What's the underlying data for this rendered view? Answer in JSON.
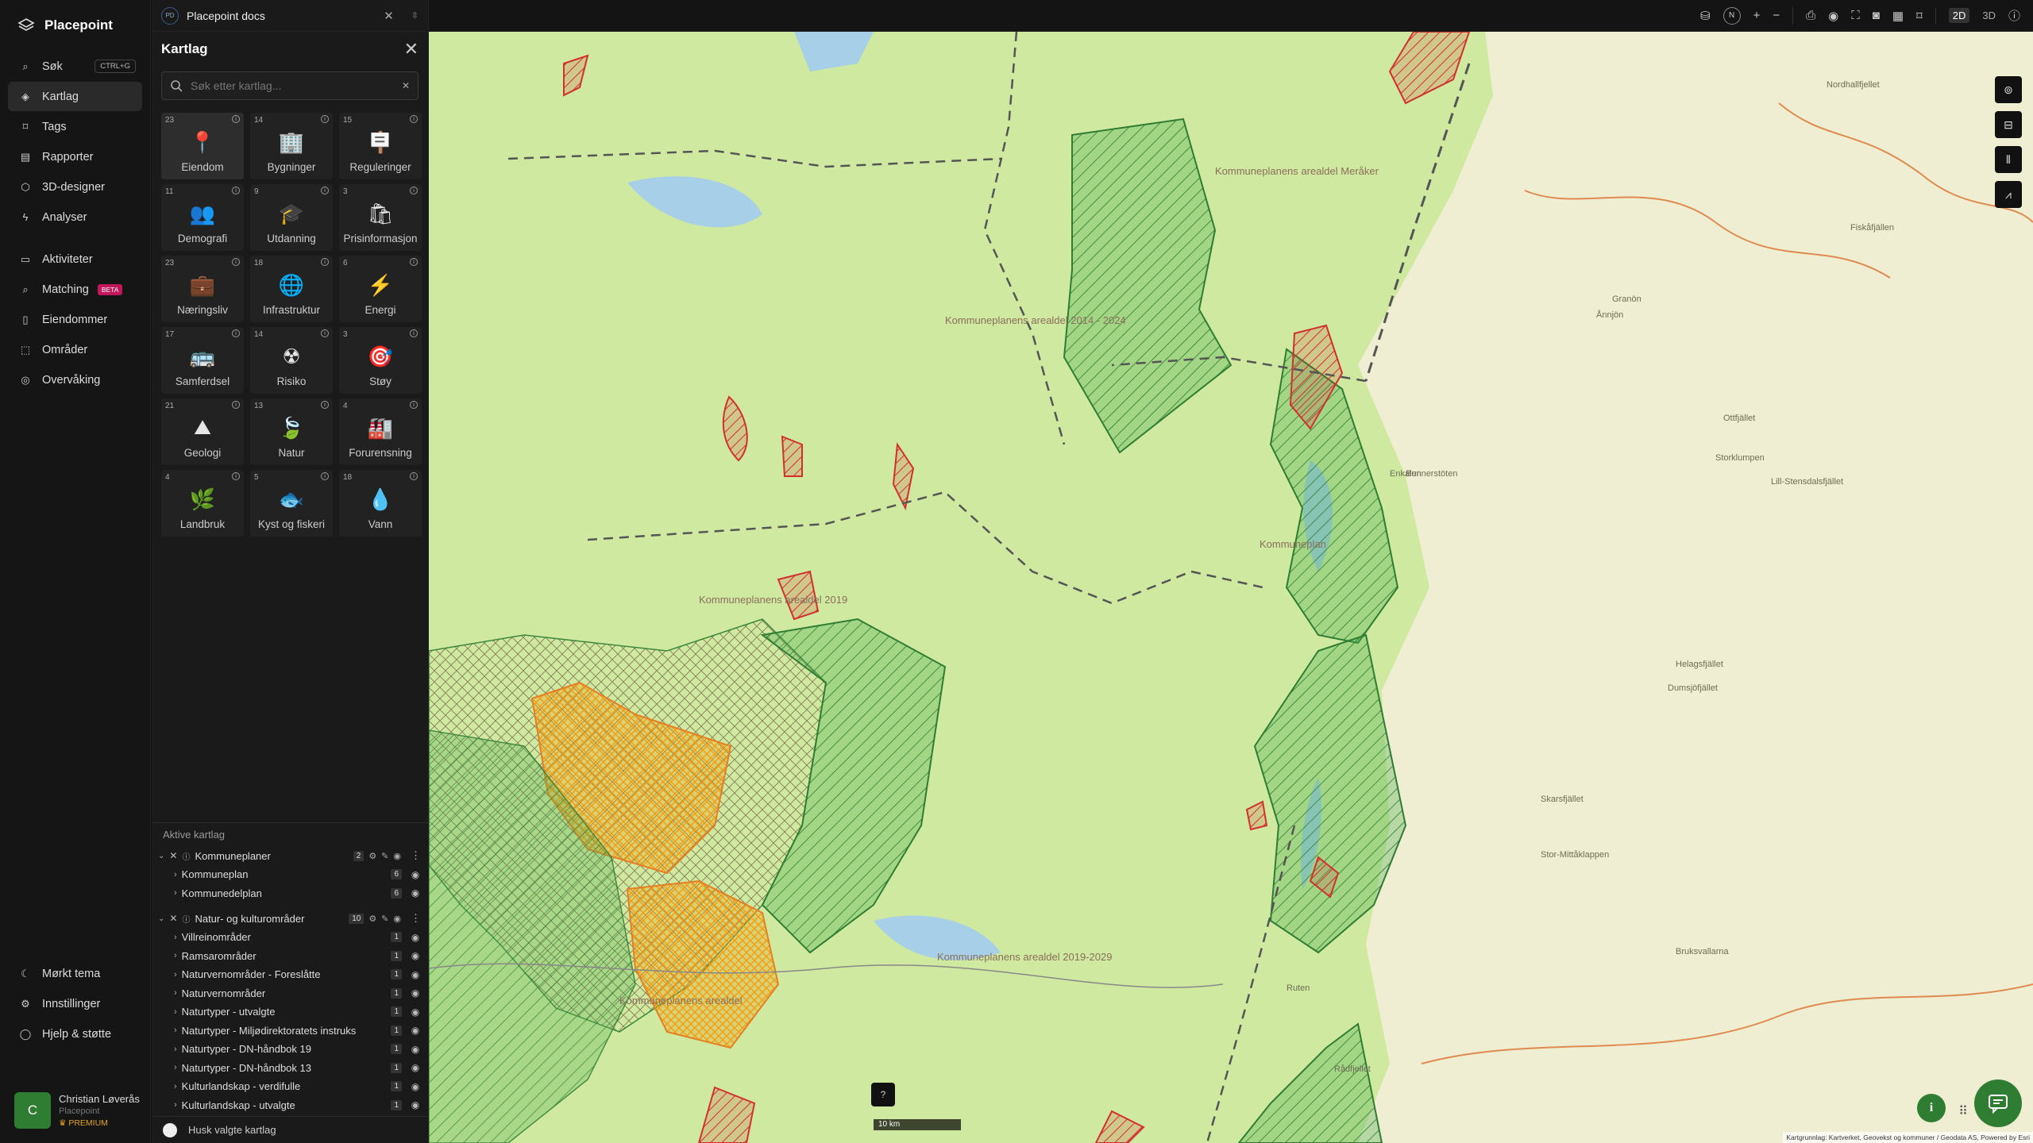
{
  "brand": {
    "name": "Placepoint"
  },
  "nav": {
    "items": [
      {
        "label": "Søk",
        "shortcut": "CTRL+G",
        "icon": "search-icon"
      },
      {
        "label": "Kartlag",
        "icon": "layers-icon",
        "active": true
      },
      {
        "label": "Tags",
        "icon": "tag-icon"
      },
      {
        "label": "Rapporter",
        "icon": "chart-icon"
      },
      {
        "label": "3D-designer",
        "icon": "cube-icon"
      },
      {
        "label": "Analyser",
        "icon": "bolt-icon"
      }
    ],
    "items2": [
      {
        "label": "Aktiviteter",
        "icon": "chat-icon"
      },
      {
        "label": "Matching",
        "badge": "BETA",
        "icon": "match-icon"
      },
      {
        "label": "Eiendommer",
        "icon": "document-icon"
      },
      {
        "label": "Områder",
        "icon": "area-icon"
      },
      {
        "label": "Overvåking",
        "icon": "monitor-icon"
      }
    ],
    "bottom": [
      {
        "label": "Mørkt tema",
        "icon": "moon-icon"
      },
      {
        "label": "Innstillinger",
        "icon": "gear-icon"
      },
      {
        "label": "Hjelp & støtte",
        "icon": "help-icon"
      }
    ],
    "user": {
      "initial": "C",
      "name": "Christian Løverås",
      "org": "Placepoint",
      "plan": "PREMIUM"
    }
  },
  "tab": {
    "logo": "PD",
    "title": "Placepoint docs"
  },
  "panel": {
    "title": "Kartlag",
    "search_placeholder": "Søk etter kartlag...",
    "tiles": [
      {
        "count": "23",
        "label": "Eiendom",
        "icon": "📍"
      },
      {
        "count": "14",
        "label": "Bygninger",
        "icon": "🏢"
      },
      {
        "count": "15",
        "label": "Reguleringer",
        "icon": "🪧"
      },
      {
        "count": "11",
        "label": "Demografi",
        "icon": "👥"
      },
      {
        "count": "9",
        "label": "Utdanning",
        "icon": "🎓"
      },
      {
        "count": "3",
        "label": "Prisinformasjon",
        "icon": "🛍"
      },
      {
        "count": "23",
        "label": "Næringsliv",
        "icon": "💼"
      },
      {
        "count": "18",
        "label": "Infrastruktur",
        "icon": "🌐"
      },
      {
        "count": "6",
        "label": "Energi",
        "icon": "⚡"
      },
      {
        "count": "17",
        "label": "Samferdsel",
        "icon": "🚌"
      },
      {
        "count": "14",
        "label": "Risiko",
        "icon": "☢"
      },
      {
        "count": "3",
        "label": "Støy",
        "icon": "🎯"
      },
      {
        "count": "21",
        "label": "Geologi",
        "icon": "⛰"
      },
      {
        "count": "13",
        "label": "Natur",
        "icon": "🍃"
      },
      {
        "count": "4",
        "label": "Forurensning",
        "icon": "🏭"
      },
      {
        "count": "4",
        "label": "Landbruk",
        "icon": "🌿"
      },
      {
        "count": "5",
        "label": "Kyst og fiskeri",
        "icon": "🐟"
      },
      {
        "count": "18",
        "label": "Vann",
        "icon": "💧"
      }
    ]
  },
  "active": {
    "title": "Aktive kartlag",
    "groups": [
      {
        "name": "Kommuneplaner",
        "count": "2",
        "rows": [
          {
            "name": "Kommuneplan",
            "count": "6"
          },
          {
            "name": "Kommunedelplan",
            "count": "6"
          }
        ]
      },
      {
        "name": "Natur- og kulturområder",
        "count": "10",
        "rows": [
          {
            "name": "Villreinområder",
            "count": "1"
          },
          {
            "name": "Ramsarområder",
            "count": "1"
          },
          {
            "name": "Naturvernområder - Foreslåtte",
            "count": "1"
          },
          {
            "name": "Naturvernområder",
            "count": "1"
          },
          {
            "name": "Naturtyper - utvalgte",
            "count": "1"
          },
          {
            "name": "Naturtyper - Miljødirektoratets instruks",
            "count": "1"
          },
          {
            "name": "Naturtyper - DN-håndbok 19",
            "count": "1"
          },
          {
            "name": "Naturtyper - DN-håndbok 13",
            "count": "1"
          },
          {
            "name": "Kulturlandskap - verdifulle",
            "count": "1"
          },
          {
            "name": "Kulturlandskap - utvalgte",
            "count": "1"
          }
        ]
      }
    ],
    "remember": "Husk valgte kartlag"
  },
  "topbar": {
    "north": "N",
    "mode2d": "2D",
    "mode3d": "3D"
  },
  "map": {
    "scale": "10 km",
    "attribution": "Kartgrunnlag: Kartverket, Geovekst og kommuner / Geodata AS, Powered by Esri",
    "colors": {
      "land": "#cfe9a0",
      "terrain": "#efeed2",
      "water": "#a8cfe8",
      "plan_red": "#d32f2f",
      "zone_green": "#4caf50",
      "zone_orange": "#f39c12"
    },
    "labels": [
      {
        "text": "Kommuneplanens arealdel Meråker"
      },
      {
        "text": "Kommuneplanens arealdel 2014 - 2024"
      },
      {
        "text": "Kommuneplanens arealdel 2019-2029"
      },
      {
        "text": "Kommuneplan"
      },
      {
        "text": "Kommuneplanens arealdel 2019"
      },
      {
        "text": "Kommuneplanens arealdel"
      },
      {
        "text": "Nordhallfjellet"
      },
      {
        "text": "Granön"
      },
      {
        "text": "Ånnjön"
      },
      {
        "text": "Storklumpen"
      },
      {
        "text": "Ottfjället"
      },
      {
        "text": "Lill-Stensdalsfjället"
      },
      {
        "text": "Stor-Mittåklappen"
      },
      {
        "text": "Bruksvallarna"
      },
      {
        "text": "Skarsfjället"
      },
      {
        "text": "Ruten"
      },
      {
        "text": "Dumsjöfjället"
      },
      {
        "text": "Rådfjellet"
      },
      {
        "text": "Helagsfjället"
      },
      {
        "text": "Enkalen"
      },
      {
        "text": "Fiskåfjällen"
      },
      {
        "text": "Bunnerstöten"
      }
    ]
  }
}
